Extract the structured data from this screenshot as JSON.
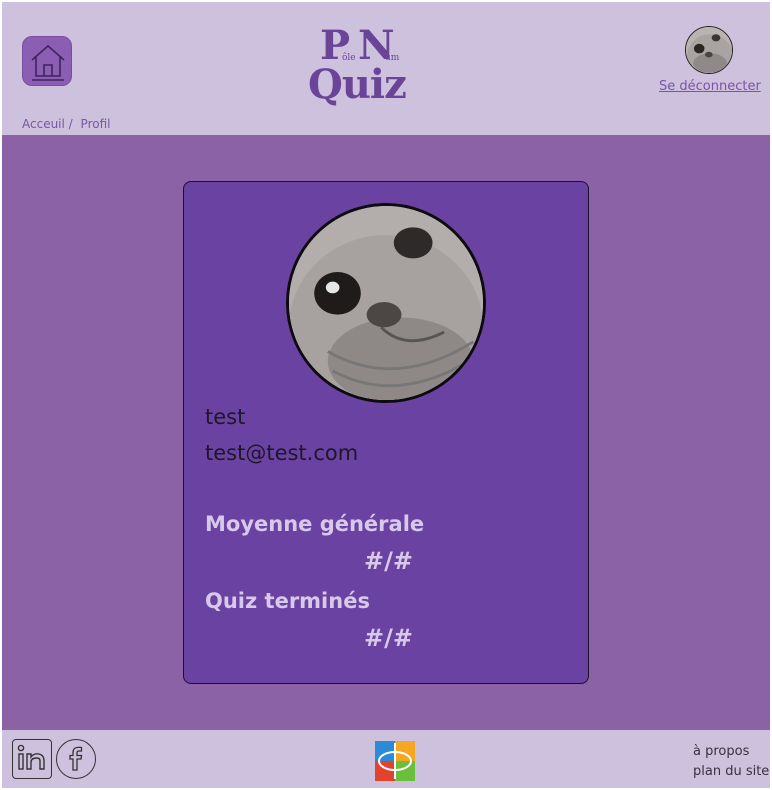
{
  "header": {
    "logo": {
      "top_letters": [
        "P",
        "N"
      ],
      "small_texts": [
        "ôle",
        "um"
      ],
      "title": "Quiz"
    },
    "logout_label": "Se déconnecter",
    "home_icon": "home-icon"
  },
  "breadcrumb": {
    "items": [
      "Acceuil /",
      "Profil"
    ]
  },
  "profile": {
    "username": "test",
    "email": "test@test.com",
    "stats": [
      {
        "label": "Moyenne générale",
        "value": "#/#"
      },
      {
        "label": "Quiz terminés",
        "value": "#/#"
      }
    ]
  },
  "footer": {
    "social": [
      "linkedin-icon",
      "facebook-icon"
    ],
    "links": [
      "à propos",
      "plan du site"
    ]
  },
  "colors": {
    "header_bg": "#cdc1dd",
    "page_bg": "#8b62a6",
    "card_bg": "#6a43a2",
    "accent": "#7a55a5"
  }
}
